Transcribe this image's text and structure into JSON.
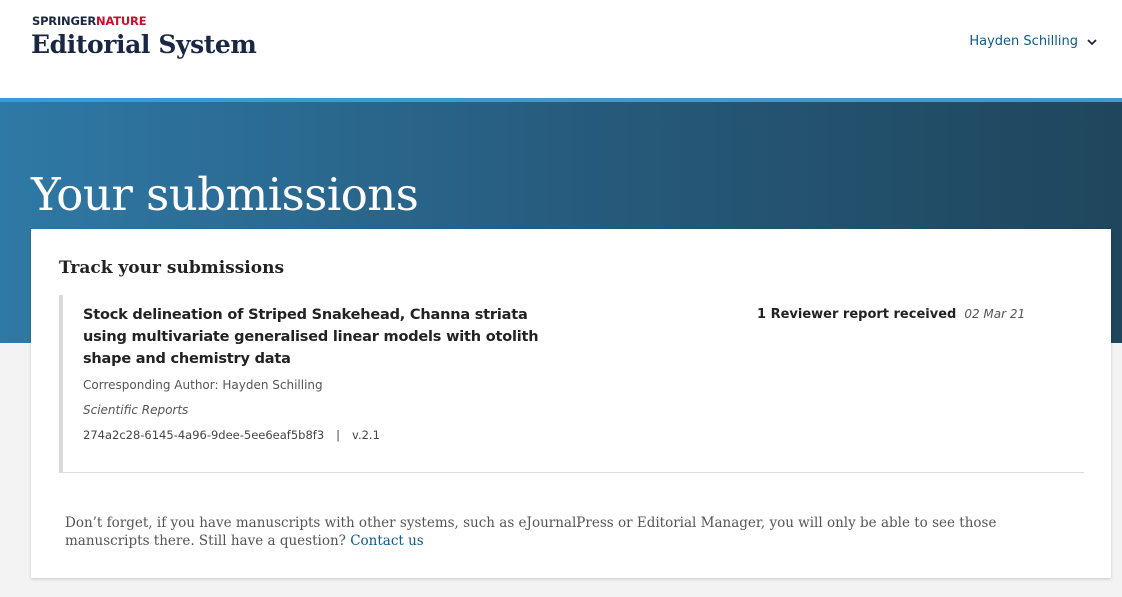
{
  "header": {
    "brand_springer": "SPRINGER",
    "brand_nature": "NATURE",
    "brand_title": "Editorial System",
    "user_name": "Hayden Schilling"
  },
  "hero": {
    "title": "Your submissions"
  },
  "card": {
    "title": "Track your submissions",
    "submission": {
      "title": "Stock delineation of Striped Snakehead, Channa striata using multivariate generalised linear models with otolith shape and chemistry data",
      "author": "Corresponding Author: Hayden Schilling",
      "journal": "Scientific Reports",
      "id": "274a2c28-6145-4a96-9dee-5ee6eaf5b8f3",
      "separator": "|",
      "version": "v.2.1",
      "status": "1 Reviewer report received",
      "date": "02 Mar 21"
    },
    "footer": {
      "text": "Don’t forget, if you have manuscripts with other systems, such as eJournalPress or Editorial Manager, you will only be able to see those manuscripts there. Still have a question?",
      "link": "Contact us"
    }
  },
  "colors": {
    "brand_navy": "#1a2742",
    "brand_red": "#c8102e",
    "link_blue": "#0b5a8a",
    "hero_start": "#2f79a6",
    "hero_end": "#1f465c",
    "stripe": "#3f99d2"
  },
  "icons": {
    "user_menu": "chevron-down-icon"
  }
}
